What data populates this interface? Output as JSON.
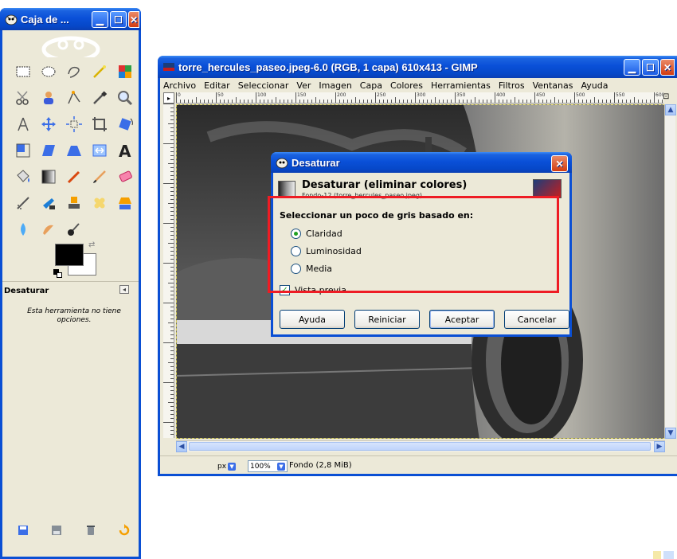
{
  "toolbox": {
    "title": "Caja de ...",
    "tool_options_title": "Desaturar",
    "tool_options_message": "Esta herramienta no tiene opciones.",
    "tools": [
      "rect-select-icon",
      "ellipse-select-icon",
      "free-select-icon",
      "fuzzy-select-icon",
      "color-select-icon",
      "scissors-icon",
      "foreground-select-icon",
      "paths-icon",
      "color-picker-icon",
      "zoom-icon",
      "measure-icon",
      "move-icon",
      "align-icon",
      "crop-icon",
      "rotate-icon",
      "scale-icon",
      "shear-icon",
      "perspective-icon",
      "flip-icon",
      "text-icon",
      "bucket-fill-icon",
      "blend-icon",
      "pencil-icon",
      "paintbrush-icon",
      "eraser-icon",
      "airbrush-icon",
      "ink-icon",
      "clone-icon",
      "heal-icon",
      "perspective-clone-icon",
      "blur-icon",
      "smudge-icon",
      "dodge-burn-icon"
    ]
  },
  "image_window": {
    "title": "torre_hercules_paseo.jpeg-6.0 (RGB, 1 capa) 610x413 - GIMP",
    "menu": [
      "Archivo",
      "Editar",
      "Seleccionar",
      "Ver",
      "Imagen",
      "Capa",
      "Colores",
      "Herramientas",
      "Filtros",
      "Ventanas",
      "Ayuda"
    ],
    "ruler_labels": [
      "0",
      "50",
      "100",
      "150",
      "200",
      "250",
      "300",
      "350",
      "400",
      "450",
      "500",
      "550",
      "600"
    ],
    "unit": "px",
    "zoom": "100%",
    "status": "Fondo (2,8 MiB)"
  },
  "dialog": {
    "title": "Desaturar",
    "heading": "Desaturar (eliminar colores)",
    "subheading": "Fondo-12 (torre_hercules_paseo.jpeg)",
    "section_label": "Seleccionar un poco de gris basado en:",
    "options": [
      {
        "label": "Claridad",
        "selected": true
      },
      {
        "label": "Luminosidad",
        "selected": false
      },
      {
        "label": "Media",
        "selected": false
      }
    ],
    "preview_label": "Vista previa",
    "preview_checked": true,
    "buttons": {
      "help": "Ayuda",
      "reset": "Reiniciar",
      "ok": "Aceptar",
      "cancel": "Cancelar"
    }
  },
  "colors": {
    "xp_blue": "#0a50d8",
    "highlight": "#ee1c24",
    "window_bg": "#ece9d8"
  }
}
